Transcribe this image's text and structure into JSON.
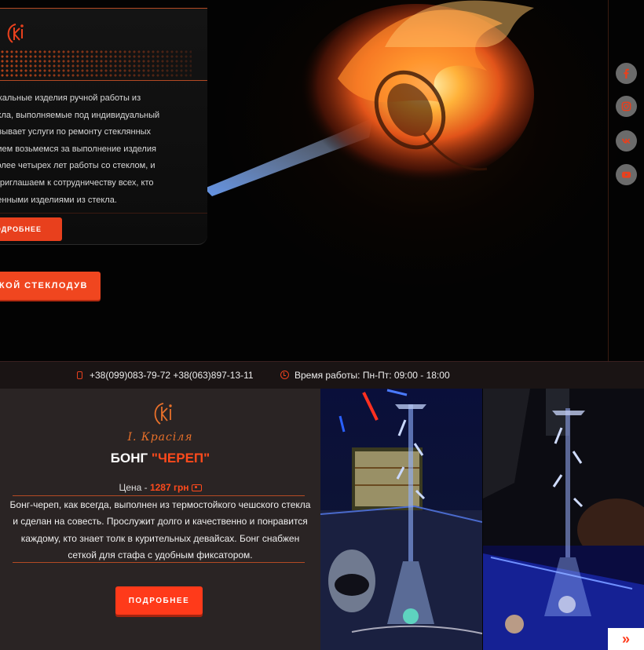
{
  "hero": {
    "about_lines": [
      "уникальные изделия ручной работы из",
      "стекла, выполняемые под индивидуальный",
      "оказывает услуги по ремонту стеклянных",
      "ствием возьмемся за выполнение изделия",
      "о более четырех лет работы со стеклом, и",
      "в. Приглашаем к сотрудничеству всех, кто",
      "ственными изделиями из стекла."
    ],
    "more_button": "ОДРОБНЕЕ",
    "cta_button": "СКОЙ СТЕКЛОДУВ"
  },
  "social": [
    {
      "name": "facebook",
      "icon": "facebook-icon"
    },
    {
      "name": "instagram",
      "icon": "instagram-icon"
    },
    {
      "name": "vk",
      "icon": "vk-icon"
    },
    {
      "name": "youtube",
      "icon": "youtube-icon"
    }
  ],
  "info_bar": {
    "phones": "+38(099)083-79-72  +38(063)897-13-11",
    "hours": "Время работы: Пн-Пт: 09:00 - 18:00"
  },
  "product": {
    "brand": "І. Красіля",
    "title_prefix": "БОНГ ",
    "title_accent": "\"ЧЕРЕП\"",
    "price_label": "Цена - ",
    "price_value": "1287 грн",
    "description": "Бонг-череп, как всегда, выполнен из термостойкого чешского стекла и сделан на совесть. Прослужит долго и качественно и понравится каждому, кто знает толк в курительных девайсах. Бонг снабжен сеткой для стафа с удобным фиксатором.",
    "button": "ПОДРОБНЕЕ"
  },
  "next_arrow": "»",
  "colors": {
    "accent": "#ff3a1a",
    "bar": "#1a1414",
    "product_bg": "#2a2424",
    "social_bg": "#6b6b6b"
  }
}
